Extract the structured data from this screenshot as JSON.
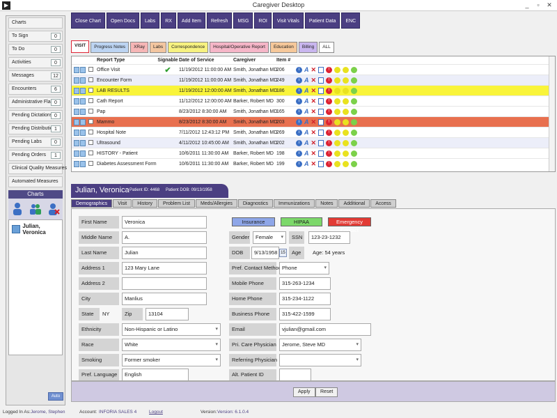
{
  "window": {
    "title": "Caregiver Desktop",
    "minimize": "_",
    "restore": "▫",
    "close": "✕",
    "icon_glyph": "▶"
  },
  "sidebar": {
    "items": [
      {
        "label": "Charts",
        "count": ""
      },
      {
        "label": "To Sign",
        "count": "0"
      },
      {
        "label": "To Do",
        "count": "0"
      },
      {
        "label": "Activities",
        "count": "0"
      },
      {
        "label": "Messages",
        "count": "12"
      },
      {
        "label": "Encounters",
        "count": "6"
      },
      {
        "label": "Administrative Flags",
        "count": "0"
      },
      {
        "label": "Pending Dictations",
        "count": "0"
      },
      {
        "label": "Pending Distributions",
        "count": "1"
      },
      {
        "label": "Pending Labs",
        "count": "0"
      },
      {
        "label": "Pending Orders",
        "count": "1"
      },
      {
        "label": "Clinical Quality Measures",
        "count": ""
      },
      {
        "label": "Automated Measures",
        "count": ""
      }
    ],
    "charts_header": "Charts",
    "patient": "Julian, Veronica",
    "bottom_button": "Auto"
  },
  "toolbar": [
    "Close Chart",
    "Open Docs",
    "Labs",
    "RX",
    "Add Item",
    "Refresh",
    "MSG",
    "ROI",
    "Visit Vitals",
    "Patient Data",
    "ENC"
  ],
  "doc_tabs": [
    {
      "label": "VISIT",
      "cls": "visit"
    },
    {
      "label": "Progress Notes",
      "cls": "pn"
    },
    {
      "label": "XRay",
      "cls": "xr"
    },
    {
      "label": "Labs",
      "cls": "lb"
    },
    {
      "label": "Correspondence",
      "cls": "co"
    },
    {
      "label": "Hospital/Operative Report",
      "cls": "ho"
    },
    {
      "label": "Education",
      "cls": "ed"
    },
    {
      "label": "Billing",
      "cls": "bi"
    },
    {
      "label": "ALL",
      "cls": "al"
    }
  ],
  "doc_table": {
    "headers": {
      "type": "Report Type",
      "signable": "Signable",
      "date": "Date of Service",
      "caregiver": "Caregiver",
      "item": "Item #"
    },
    "signed_mark": "✔",
    "rows": [
      {
        "type": "Office Visit",
        "signed": true,
        "date": "11/19/2012 11:00:00 AM",
        "caregiver": "Smith, Jonathan MD",
        "item": "206",
        "hl": ""
      },
      {
        "type": "Encounter Form",
        "signed": false,
        "date": "11/19/2012 11:00:00 AM",
        "caregiver": "Smith, Jonathan MD",
        "item": "249",
        "hl": "alt"
      },
      {
        "type": "LAB RESULTS",
        "signed": false,
        "date": "11/19/2012 12:00:00 AM",
        "caregiver": "Smith, Jonathan MD",
        "item": "186",
        "hl": "hl-yellow"
      },
      {
        "type": "Cath Report",
        "signed": false,
        "date": "11/12/2012 12:00:00 AM",
        "caregiver": "Barker, Robert MD",
        "item": "300",
        "hl": ""
      },
      {
        "type": "Pap",
        "signed": false,
        "date": "8/23/2012 8:30:00 AM",
        "caregiver": "Smith, Jonathan MD",
        "item": "165",
        "hl": ""
      },
      {
        "type": "Mammo",
        "signed": false,
        "date": "8/23/2012 8:30:00 AM",
        "caregiver": "Smith, Jonathan MD",
        "item": "203",
        "hl": "hl-red"
      },
      {
        "type": "Hospital Note",
        "signed": false,
        "date": "7/11/2012 12:43:12 PM",
        "caregiver": "Smith, Jonathan MD",
        "item": "269",
        "hl": ""
      },
      {
        "type": "Ultrasound",
        "signed": false,
        "date": "4/11/2012 10:45:00 AM",
        "caregiver": "Smith, Jonathan MD",
        "item": "202",
        "hl": "alt"
      },
      {
        "type": "HISTORY - Patient",
        "signed": false,
        "date": "10/6/2011 11:30:00 AM",
        "caregiver": "Barker, Robert MD",
        "item": "198",
        "hl": ""
      },
      {
        "type": "Diabetes Assessment Form",
        "signed": false,
        "date": "10/6/2011 11:30:00 AM",
        "caregiver": "Barker, Robert MD",
        "item": "199",
        "hl": ""
      }
    ]
  },
  "patient": {
    "name": "Julian, Veronica",
    "id_text": "Patient ID: 4468",
    "dob_text": "Patient DOB: 09/13/1958"
  },
  "detail_tabs": [
    "Demographics",
    "Visit",
    "History",
    "Problem List",
    "Meds/Allergies",
    "Diagnostics",
    "Immunizations",
    "Notes",
    "Additional",
    "Access"
  ],
  "form": {
    "first_name": {
      "label": "First Name",
      "value": "Veronica"
    },
    "middle_name": {
      "label": "Middle Name",
      "value": "A."
    },
    "last_name": {
      "label": "Last Name",
      "value": "Julian"
    },
    "address1": {
      "label": "Address 1",
      "value": "123 Mary Lane"
    },
    "address2": {
      "label": "Address 2",
      "value": ""
    },
    "city": {
      "label": "City",
      "value": "Manlius"
    },
    "state": {
      "label": "State",
      "value": "NY"
    },
    "zip": {
      "label": "Zip",
      "value": "13104"
    },
    "ethnicity": {
      "label": "Ethnicity",
      "value": "Non-Hispanic or Latino"
    },
    "race": {
      "label": "Race",
      "value": "White"
    },
    "smoking": {
      "label": "Smoking",
      "value": "Former smoker"
    },
    "language": {
      "label": "Pref. Language",
      "value": "English"
    },
    "insurance_btn": "Insurance",
    "hipaa_btn": "HIPAA",
    "emergency_btn": "Emergency Contact",
    "gender": {
      "label": "Gender",
      "value": "Female"
    },
    "ssn": {
      "label": "SSN",
      "value": "123-23-1232"
    },
    "dob": {
      "label": "DOB",
      "value": "9/13/1958",
      "cal": "15"
    },
    "age": {
      "label": "Age",
      "value": "Age: 54 years"
    },
    "contact_method": {
      "label": "Pref. Contact Method",
      "value": "Phone"
    },
    "mobile": {
      "label": "Mobile Phone",
      "value": "315-263-1234"
    },
    "home": {
      "label": "Home Phone",
      "value": "315-234-1122"
    },
    "business": {
      "label": "Business Phone",
      "value": "315-422-1599"
    },
    "email": {
      "label": "Email",
      "value": "vjulian@gmail.com"
    },
    "pcp": {
      "label": "Pri. Care Physician",
      "value": "Jerome, Steve MD"
    },
    "ref_phys": {
      "label": "Referring Physician",
      "value": ""
    },
    "alt_id": {
      "label": "Alt. Patient ID",
      "value": ""
    },
    "apply": "Apply",
    "reset": "Reset"
  },
  "statusbar": {
    "logged_label": "Logged In As:",
    "logged_value": "Jerome, Stephen",
    "account_label": "Account:",
    "account_value": "INFORIA SALES 4",
    "logout": "Logout",
    "version_label": "Version:",
    "version_value": "Version: 6.1.0.4"
  },
  "colors": {
    "accent": "#4b3f82",
    "highlight_yellow": "#f9f43a",
    "highlight_red": "#e8704f",
    "insurance": "#8ea6e8",
    "hipaa": "#7cd86a",
    "emergency": "#e23b35"
  }
}
